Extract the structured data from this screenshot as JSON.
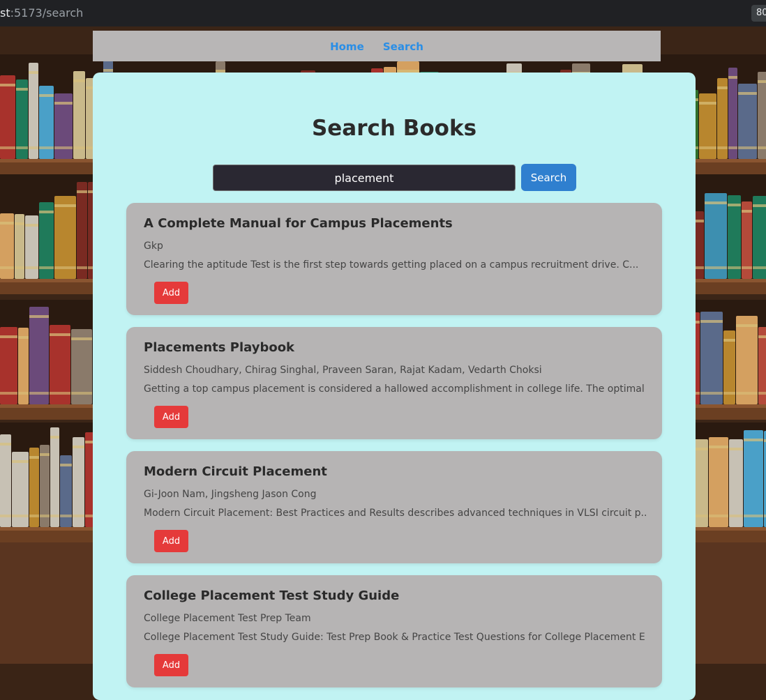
{
  "browser": {
    "url_prefix": "st",
    "url_rest": ":5173/search",
    "zoom": "80"
  },
  "nav": {
    "home": "Home",
    "search": "Search"
  },
  "page": {
    "title": "Search Books"
  },
  "search": {
    "value": "placement",
    "button": "Search"
  },
  "results": [
    {
      "title": "A Complete Manual for Campus Placements",
      "authors": "Gkp",
      "description": "Clearing the aptitude Test is the first step towards getting placed on a campus recruitment drive. C...",
      "add_label": "Add"
    },
    {
      "title": "Placements Playbook",
      "authors": "Siddesh Choudhary, Chirag Singhal, Praveen Saran, Rajat Kadam, Vedarth Choksi",
      "description": "Getting a top campus placement is considered a hallowed accomplishment in college life. The optimal ...",
      "add_label": "Add"
    },
    {
      "title": "Modern Circuit Placement",
      "authors": "Gi-Joon Nam, Jingsheng Jason Cong",
      "description": "Modern Circuit Placement: Best Practices and Results describes advanced techniques in VLSI circuit p...",
      "add_label": "Add"
    },
    {
      "title": "College Placement Test Study Guide",
      "authors": "College Placement Test Prep Team",
      "description": "College Placement Test Study Guide: Test Prep Book & Practice Test Questions for College Placement E...",
      "add_label": "Add"
    }
  ]
}
